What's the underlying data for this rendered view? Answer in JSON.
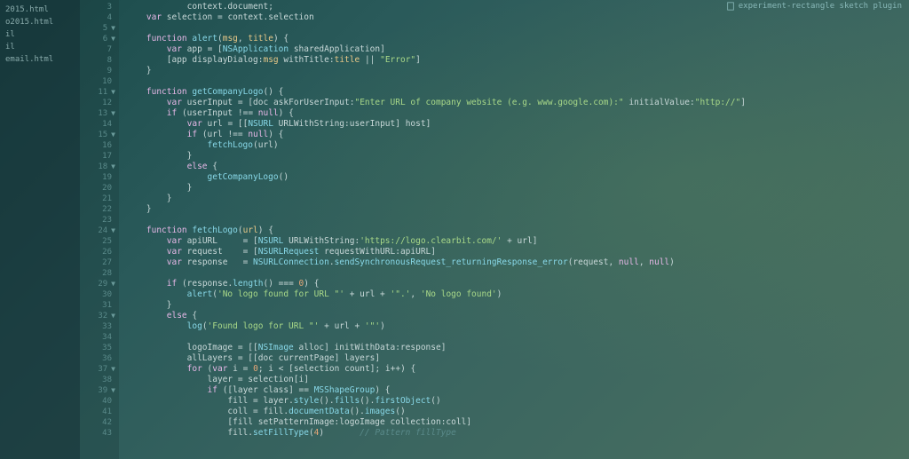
{
  "sidebar": {
    "items": [
      {
        "label": "2015.html"
      },
      {
        "label": "o2015.html"
      },
      {
        "label": "il"
      },
      {
        "label": "il"
      },
      {
        "label": "email.html"
      }
    ]
  },
  "tab": {
    "label": "experiment-rectangle sketch plugin"
  },
  "code": {
    "lines": [
      {
        "n": 3,
        "fold": "",
        "html": "            <span class='id'>context</span>.<span class='id'>document</span>;"
      },
      {
        "n": 4,
        "fold": "",
        "html": "    <span class='kw'>var</span> <span class='id'>selection</span> = <span class='id'>context</span>.<span class='id'>selection</span>"
      },
      {
        "n": 5,
        "fold": "▼",
        "html": ""
      },
      {
        "n": 6,
        "fold": "▼",
        "html": "    <span class='kw'>function</span> <span class='fn'>alert</span>(<span class='var'>msg</span>, <span class='var'>title</span>) {"
      },
      {
        "n": 7,
        "fold": "",
        "html": "        <span class='kw'>var</span> <span class='id'>app</span> = [<span class='fn'>NSApplication</span> <span class='id'>sharedApplication</span>]"
      },
      {
        "n": 8,
        "fold": "",
        "html": "        [<span class='id'>app</span> <span class='id'>displayDialog</span>:<span class='var'>msg</span> <span class='id'>withTitle</span>:<span class='var'>title</span> || <span class='str'>\"Error\"</span>]"
      },
      {
        "n": 9,
        "fold": "",
        "html": "    }"
      },
      {
        "n": 10,
        "fold": "",
        "html": ""
      },
      {
        "n": 11,
        "fold": "▼",
        "html": "    <span class='kw'>function</span> <span class='fn'>getCompanyLogo</span>() {"
      },
      {
        "n": 12,
        "fold": "",
        "html": "        <span class='kw'>var</span> <span class='id'>userInput</span> = [<span class='id'>doc</span> <span class='id'>askForUserInput</span>:<span class='str'>\"Enter URL of company website (e.g. www.google.com):\"</span> <span class='id'>initialValue</span>:<span class='str'>\"http://\"</span>]"
      },
      {
        "n": 13,
        "fold": "▼",
        "html": "        <span class='kw'>if</span> (<span class='id'>userInput</span> !== <span class='kw'>null</span>) {"
      },
      {
        "n": 14,
        "fold": "",
        "html": "            <span class='kw'>var</span> <span class='id'>url</span> = [[<span class='fn'>NSURL</span> <span class='id'>URLWithString</span>:<span class='id'>userInput</span>] <span class='id'>host</span>]"
      },
      {
        "n": 15,
        "fold": "▼",
        "html": "            <span class='kw'>if</span> (<span class='id'>url</span> !== <span class='kw'>null</span>) {"
      },
      {
        "n": 16,
        "fold": "",
        "html": "                <span class='fn'>fetchLogo</span>(<span class='id'>url</span>)"
      },
      {
        "n": 17,
        "fold": "",
        "html": "            }"
      },
      {
        "n": 18,
        "fold": "▼",
        "html": "            <span class='kw'>else</span> {"
      },
      {
        "n": 19,
        "fold": "",
        "html": "                <span class='fn'>getCompanyLogo</span>()"
      },
      {
        "n": 20,
        "fold": "",
        "html": "            }"
      },
      {
        "n": 21,
        "fold": "",
        "html": "        }"
      },
      {
        "n": 22,
        "fold": "",
        "html": "    }"
      },
      {
        "n": 23,
        "fold": "",
        "html": ""
      },
      {
        "n": 24,
        "fold": "▼",
        "html": "    <span class='kw'>function</span> <span class='fn'>fetchLogo</span>(<span class='var'>url</span>) {"
      },
      {
        "n": 25,
        "fold": "",
        "html": "        <span class='kw'>var</span> <span class='id'>apiURL</span>     = [<span class='fn'>NSURL</span> <span class='id'>URLWithString</span>:<span class='str'>'https://logo.clearbit.com/'</span> + <span class='id'>url</span>]"
      },
      {
        "n": 26,
        "fold": "",
        "html": "        <span class='kw'>var</span> <span class='id'>request</span>    = [<span class='fn'>NSURLRequest</span> <span class='id'>requestWithURL</span>:<span class='id'>apiURL</span>]"
      },
      {
        "n": 27,
        "fold": "",
        "html": "        <span class='kw'>var</span> <span class='id'>response</span>   = <span class='fn'>NSURLConnection</span>.<span class='fn'>sendSynchronousRequest_returningResponse_error</span>(<span class='id'>request</span>, <span class='kw'>null</span>, <span class='kw'>null</span>)"
      },
      {
        "n": 28,
        "fold": "",
        "html": ""
      },
      {
        "n": 29,
        "fold": "▼",
        "html": "        <span class='kw'>if</span> (<span class='id'>response</span>.<span class='fn'>length</span>() === <span class='num'>0</span>) {"
      },
      {
        "n": 30,
        "fold": "",
        "html": "            <span class='fn'>alert</span>(<span class='str'>'No logo found for URL \"'</span> + <span class='id'>url</span> + <span class='str'>'\".'</span>, <span class='str'>'No logo found'</span>)"
      },
      {
        "n": 31,
        "fold": "",
        "html": "        }"
      },
      {
        "n": 32,
        "fold": "▼",
        "html": "        <span class='kw'>else</span> {"
      },
      {
        "n": 33,
        "fold": "",
        "html": "            <span class='fn'>log</span>(<span class='str'>'Found logo for URL \"'</span> + <span class='id'>url</span> + <span class='str'>'\"'</span>)"
      },
      {
        "n": 34,
        "fold": "",
        "html": ""
      },
      {
        "n": 35,
        "fold": "",
        "html": "            <span class='id'>logoImage</span> = [[<span class='fn'>NSImage</span> <span class='id'>alloc</span>] <span class='id'>initWithData</span>:<span class='id'>response</span>]"
      },
      {
        "n": 36,
        "fold": "",
        "html": "            <span class='id'>allLayers</span> = [[<span class='id'>doc</span> <span class='id'>currentPage</span>] <span class='id'>layers</span>]"
      },
      {
        "n": 37,
        "fold": "▼",
        "html": "            <span class='kw'>for</span> (<span class='kw'>var</span> <span class='id'>i</span> = <span class='num'>0</span>; <span class='id'>i</span> &lt; [<span class='id'>selection</span> <span class='id'>count</span>]; <span class='id'>i</span>++) {"
      },
      {
        "n": 38,
        "fold": "",
        "html": "                <span class='id'>layer</span> = <span class='id'>selection</span>[<span class='id'>i</span>]"
      },
      {
        "n": 39,
        "fold": "▼",
        "html": "                <span class='kw'>if</span> ([<span class='id'>layer</span> <span class='id'>class</span>] == <span class='fn'>MSShapeGroup</span>) {"
      },
      {
        "n": 40,
        "fold": "",
        "html": "                    <span class='id'>fill</span> = <span class='id'>layer</span>.<span class='fn'>style</span>().<span class='fn'>fills</span>().<span class='fn'>firstObject</span>()"
      },
      {
        "n": 41,
        "fold": "",
        "html": "                    <span class='id'>coll</span> = <span class='id'>fill</span>.<span class='fn'>documentData</span>().<span class='fn'>images</span>()"
      },
      {
        "n": 42,
        "fold": "",
        "html": "                    [<span class='id'>fill</span> <span class='id'>setPatternImage</span>:<span class='id'>logoImage</span> <span class='id'>collection</span>:<span class='id'>coll</span>]"
      },
      {
        "n": 43,
        "fold": "",
        "html": "                    <span class='id'>fill</span>.<span class='fn'>setFillType</span>(<span class='num'>4</span>)       <span class='cmt'>// Pattern fillType</span>"
      }
    ]
  }
}
